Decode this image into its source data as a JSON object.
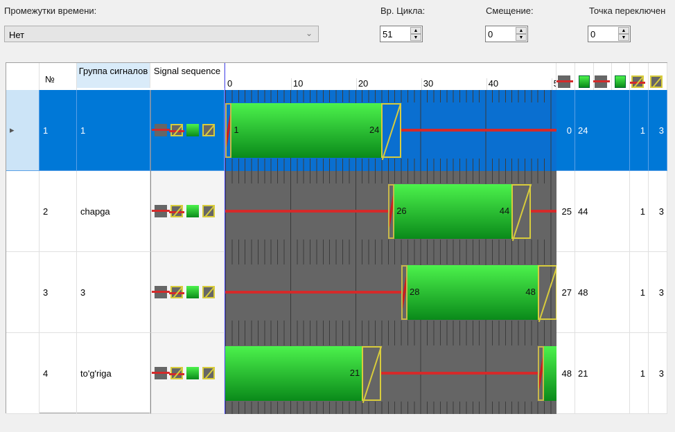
{
  "top": {
    "intervals_label": "Промежутки времени:",
    "intervals_value": "Нет",
    "cycle_label": "Вр. Цикла:",
    "cycle_value": "51",
    "offset_label": "Смещение:",
    "offset_value": "0",
    "switch_label": "Точка переключен",
    "switch_value": "0"
  },
  "header": {
    "num": "№",
    "group": "Группа сигналов",
    "sequence": "Signal sequence",
    "ticks": [
      "0",
      "10",
      "20",
      "30",
      "40",
      "5"
    ]
  },
  "icons": [
    "red-stop-icon",
    "green-icon",
    "red-stop-icon",
    "green-icon",
    "red-yellow-icon",
    "yellow-icon"
  ],
  "cycle": 51,
  "rows": [
    {
      "num": "1",
      "group": "1",
      "selected": true,
      "segments": [
        [
          "redtrans",
          0,
          1
        ],
        [
          "green",
          1,
          24
        ],
        [
          "yellow",
          24,
          27
        ],
        [
          "red",
          27,
          51
        ]
      ],
      "labels": [
        [
          "1",
          1,
          "start"
        ],
        [
          "24",
          24,
          "end"
        ]
      ],
      "cols": [
        "0",
        "24",
        "",
        "",
        "1",
        "3"
      ]
    },
    {
      "num": "2",
      "group": "chapga",
      "selected": false,
      "segments": [
        [
          "red",
          0,
          25
        ],
        [
          "redtrans",
          25,
          26
        ],
        [
          "green",
          26,
          44
        ],
        [
          "yellow",
          44,
          47
        ],
        [
          "red",
          47,
          51
        ]
      ],
      "labels": [
        [
          "26",
          26,
          "start"
        ],
        [
          "44",
          44,
          "end"
        ]
      ],
      "cols": [
        "25",
        "44",
        "",
        "",
        "1",
        "3"
      ]
    },
    {
      "num": "3",
      "group": "3",
      "selected": false,
      "segments": [
        [
          "red",
          0,
          27
        ],
        [
          "redtrans",
          27,
          28
        ],
        [
          "green",
          28,
          48
        ],
        [
          "yellow",
          48,
          51
        ]
      ],
      "labels": [
        [
          "28",
          28,
          "start"
        ],
        [
          "48",
          48,
          "end"
        ]
      ],
      "cols": [
        "27",
        "48",
        "",
        "",
        "1",
        "3"
      ]
    },
    {
      "num": "4",
      "group": "to'g'riga",
      "selected": false,
      "segments": [
        [
          "green",
          0,
          21
        ],
        [
          "yellow",
          21,
          24
        ],
        [
          "red",
          24,
          48
        ],
        [
          "redtrans",
          48,
          49
        ],
        [
          "green",
          49,
          51
        ]
      ],
      "labels": [
        [
          "21",
          21,
          "end"
        ]
      ],
      "cols": [
        "48",
        "21",
        "",
        "",
        "1",
        "3"
      ]
    }
  ]
}
